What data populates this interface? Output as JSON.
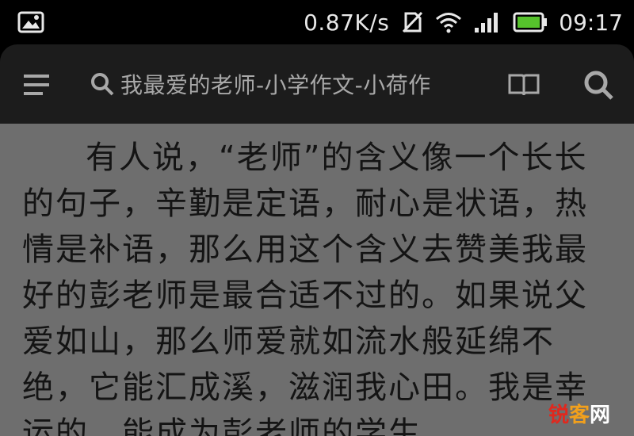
{
  "status_bar": {
    "net_speed": "0.87K/s",
    "time": "09:17",
    "icons": [
      "image-notification-icon",
      "no-sim-icon",
      "wifi-icon",
      "cellular-signal-icon",
      "battery-icon"
    ],
    "battery_color": "#56c22c"
  },
  "app_bar": {
    "search_text": "我最爱的老师-小学作文-小荷作",
    "icons": [
      "menu-icon",
      "search-icon",
      "book-icon"
    ]
  },
  "article": {
    "text": "有人说，“老师”的含义像一个长长的句子，辛勤是定语，耐心是状语，热情是补语，那么用这个含义去赞美我最好的彭老师是最合适不过的。如果说父爱如山，那么师爱就如流水般延绵不绝，它能汇成溪，滋润我心田。我是幸运的，能成为彭老师的学生"
  },
  "watermark": {
    "part1": "锐",
    "part2": "客",
    "part3": "网"
  }
}
